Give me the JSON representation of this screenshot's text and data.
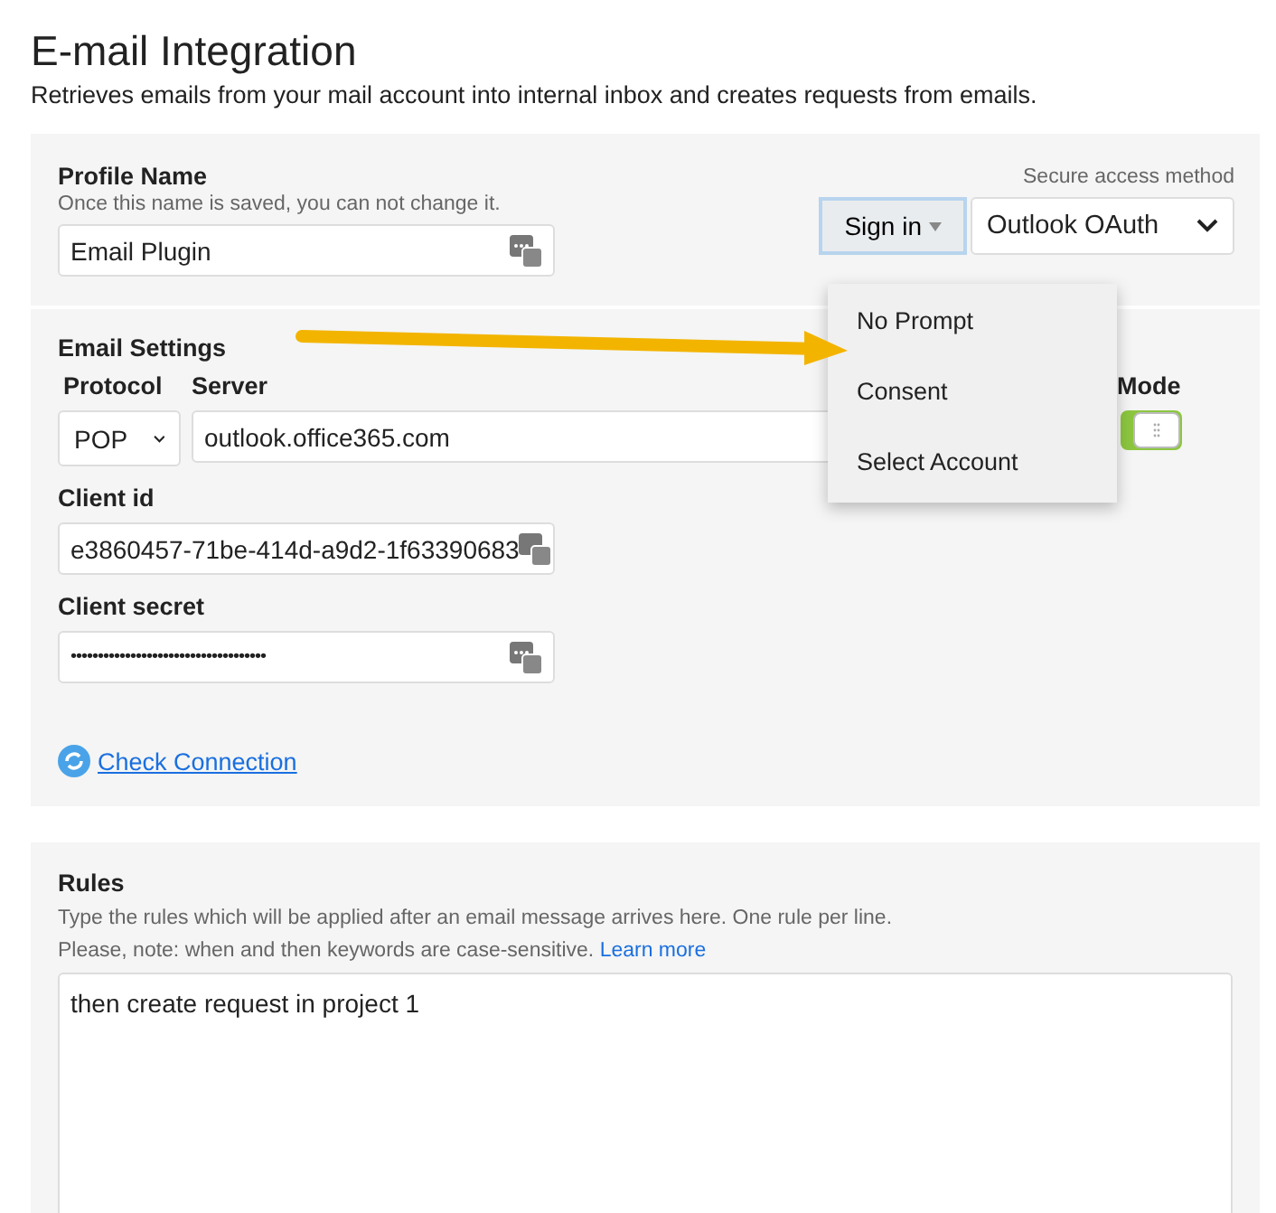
{
  "page": {
    "title": "E-mail Integration",
    "subtitle": "Retrieves emails from your mail account into internal inbox and creates requests from emails."
  },
  "profile": {
    "label": "Profile Name",
    "hint": "Once this name is saved, you can not change it.",
    "value": "Email Plugin",
    "access_label": "Secure access method",
    "sign_in": "Sign in",
    "method": "Outlook OAuth"
  },
  "sign_in_menu": {
    "expanded": true,
    "items": [
      "No Prompt",
      "Consent",
      "Select Account"
    ]
  },
  "email_settings": {
    "heading": "Email Settings",
    "protocol_label": "Protocol",
    "protocol": "POP",
    "server_label": "Server",
    "server": "outlook.office365.com",
    "mode_label": "Mode",
    "mode_on": true,
    "client_id_label": "Client id",
    "client_id": "e3860457-71be-414d-a9d2-1f63390683",
    "client_secret_label": "Client secret",
    "client_secret": "••••••••••••••••••••••••••••••••••••",
    "check_link": "Check Connection"
  },
  "rules": {
    "heading": "Rules",
    "hint1": "Type the rules which will be applied after an email message arrives here. One rule per line.",
    "hint2": "Please, note: when and then keywords are case-sensitive.",
    "learn_more": "Learn more",
    "value": "then create request in project 1"
  }
}
